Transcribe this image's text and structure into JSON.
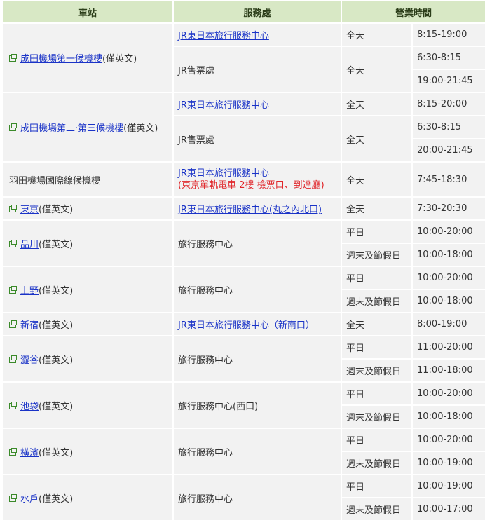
{
  "headers": {
    "station": "車站",
    "office": "服務處",
    "hours": "營業時間"
  },
  "rows": {
    "narita1": {
      "station": "成田機場第一候機樓",
      "suffix": "(僅英文)",
      "jr_center": "JR東日本旅行服務中心",
      "ticket": "JR售票處",
      "day": "全天",
      "h1": "8:15-19:00",
      "h2": "6:30-8:15",
      "h3": "19:00-21:45"
    },
    "narita2": {
      "station": "成田機場第二‧第三候機樓",
      "suffix": "(僅英文)",
      "jr_center": "JR東日本旅行服務中心",
      "ticket": "JR售票處",
      "day": "全天",
      "h1": "8:15-20:00",
      "h2": "6:30-8:15",
      "h3": "20:00-21:45"
    },
    "haneda": {
      "station": "羽田機場國際線候機樓",
      "office": "JR東日本旅行服務中心",
      "note": "(東京單軌電車 2樓 檢票口、到達廳)",
      "day": "全天",
      "hours": "7:45-18:30"
    },
    "tokyo": {
      "station": "東京",
      "suffix": "(僅英文)",
      "office": "JR東日本旅行服務中心(丸之內北口)",
      "day": "全天",
      "hours": "7:30-20:30"
    },
    "shinagawa": {
      "station": "品川",
      "suffix": "(僅英文)",
      "office": "旅行服務中心",
      "d1": "平日",
      "h1": "10:00-20:00",
      "d2": "週末及節假日",
      "h2": "10:00-18:00"
    },
    "ueno": {
      "station": "上野",
      "suffix": "(僅英文)",
      "office": "旅行服務中心",
      "d1": "平日",
      "h1": "10:00-20:00",
      "d2": "週末及節假日",
      "h2": "10:00-18:00"
    },
    "shinjuku": {
      "station": "新宿",
      "suffix": "(僅英文)",
      "office": "JR東日本旅行服務中心（新南口）",
      "day": "全天",
      "hours": "8:00-19:00"
    },
    "shibuya": {
      "station": "澀谷",
      "suffix": "(僅英文)",
      "office": "旅行服務中心",
      "d1": "平日",
      "h1": "11:00-20:00",
      "d2": "週末及節假日",
      "h2": "11:00-18:00"
    },
    "ikebukuro": {
      "station": "池袋",
      "suffix": "(僅英文)",
      "office": "旅行服務中心(西口)",
      "d1": "平日",
      "h1": "10:00-20:00",
      "d2": "週末及節假日",
      "h2": "10:00-18:00"
    },
    "yokohama": {
      "station": "橫濱",
      "suffix": "(僅英文)",
      "office": "旅行服務中心",
      "d1": "平日",
      "h1": "10:00-20:00",
      "d2": "週末及節假日",
      "h2": "10:00-19:00"
    },
    "mito": {
      "station": "水戶",
      "suffix": "(僅英文)",
      "office": "旅行服務中心",
      "d1": "平日",
      "h1": "10:00-19:00",
      "d2": "週末及節假日",
      "h2": "10:00-17:00"
    }
  }
}
